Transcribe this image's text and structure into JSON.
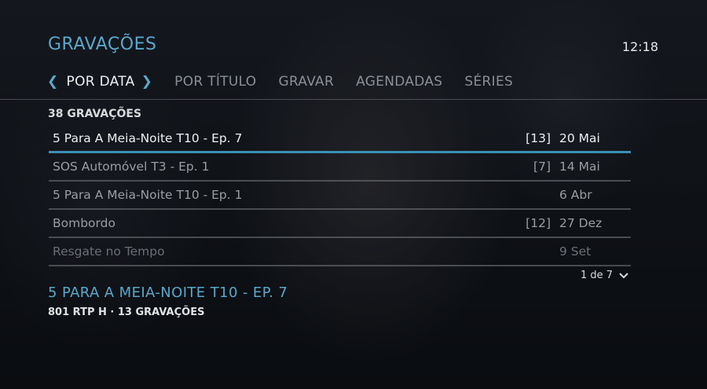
{
  "header": {
    "title": "GRAVAÇÕES",
    "clock": "12:18"
  },
  "tabs": [
    {
      "label": "POR DATA"
    },
    {
      "label": "POR TÍTULO"
    },
    {
      "label": "GRAVAR"
    },
    {
      "label": "AGENDADAS"
    },
    {
      "label": "SÉRIES"
    }
  ],
  "list": {
    "count_label": "38 GRAVAÇÕES",
    "items": [
      {
        "name": "5 Para A Meia-Noite T10 - Ep. 7",
        "badge": "[13]",
        "date": "20 Mai"
      },
      {
        "name": "SOS Automóvel T3 - Ep. 1",
        "badge": "[7]",
        "date": "14 Mai"
      },
      {
        "name": "5 Para A Meia-Noite T10 - Ep. 1",
        "badge": "",
        "date": "6 Abr"
      },
      {
        "name": "Bombordo",
        "badge": "[12]",
        "date": "27 Dez"
      },
      {
        "name": "Resgate no Tempo",
        "badge": "",
        "date": "9 Set"
      }
    ],
    "pagination": "1 de 7"
  },
  "detail": {
    "title": "5 PARA A MEIA-NOITE T10 - EP. 7",
    "subtitle": "801 RTP H · 13 GRAVAÇÕES"
  },
  "colors": {
    "accent": "#5aa8cc",
    "selection": "#3c8fb5"
  },
  "icons": {
    "prev": "chevron-left-icon",
    "next": "chevron-right-icon",
    "more": "chevron-down-icon"
  }
}
